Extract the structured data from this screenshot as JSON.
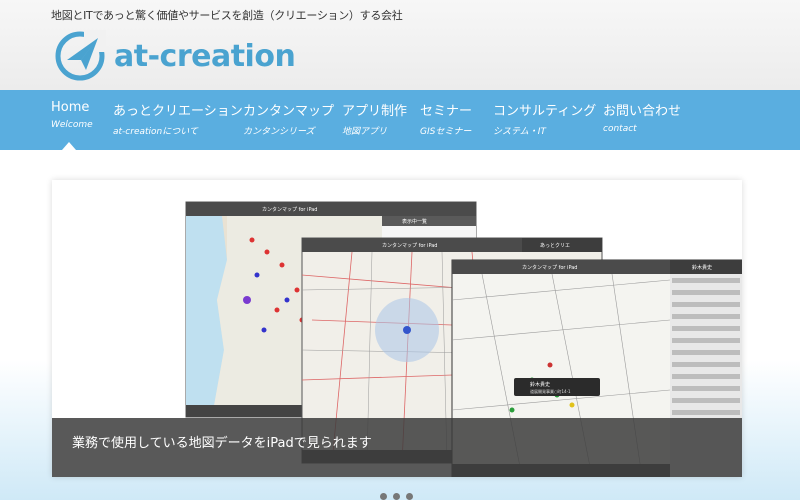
{
  "header": {
    "tagline": "地図とITであっと驚く価値やサービスを創造（クリエーション）する会社",
    "logo_text": "at-creation"
  },
  "nav": {
    "items": [
      {
        "label": "Home",
        "sub": "Welcome"
      },
      {
        "label": "あっとクリエーション",
        "sub": "at-creationについて"
      },
      {
        "label": "カンタンマップ",
        "sub": "カンタンシリーズ"
      },
      {
        "label": "アプリ制作",
        "sub": "地図アプリ"
      },
      {
        "label": "セミナー",
        "sub": "GISセミナー"
      },
      {
        "label": "コンサルティング",
        "sub": "システム・IT"
      },
      {
        "label": "お問い合わせ",
        "sub": "contact"
      }
    ]
  },
  "slider": {
    "caption": "業務で使用している地図データをiPadで見られます",
    "screens": {
      "back_title": "カンタンマップ for iPad",
      "back_panel_title": "表示中一覧",
      "mid_title": "カンタンマップ for iPad",
      "mid_panel_title": "あっとクリエ",
      "front_title": "カンタンマップ for iPad",
      "front_panel_title": "鈴木貴史",
      "popup_name": "鈴木貴史",
      "popup_sub": "道展開発事業○町14-1"
    },
    "dot_count": 3
  },
  "colors": {
    "nav_bg": "#5aaee0",
    "logo": "#4aa3d0"
  }
}
